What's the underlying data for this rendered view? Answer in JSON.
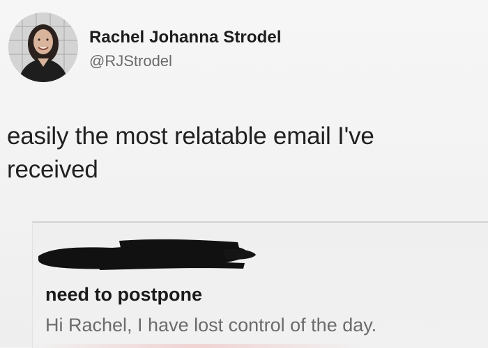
{
  "tweet": {
    "author": {
      "display_name": "Rachel Johanna Strodel",
      "handle": "@RJStrodel"
    },
    "text_lines": [
      "easily the most relatable email I've",
      "received"
    ]
  },
  "email": {
    "sender_redacted": true,
    "subject": "need to postpone",
    "preview": "Hi Rachel, I have lost control of the day."
  },
  "icons": {
    "avatar": "profile-photo"
  },
  "colors": {
    "background": "#f4f4f4",
    "name_text": "#1c1c1c",
    "handle_text": "#6a6a6a",
    "preview_text": "#6b6b6b",
    "redaction": "#111111"
  }
}
